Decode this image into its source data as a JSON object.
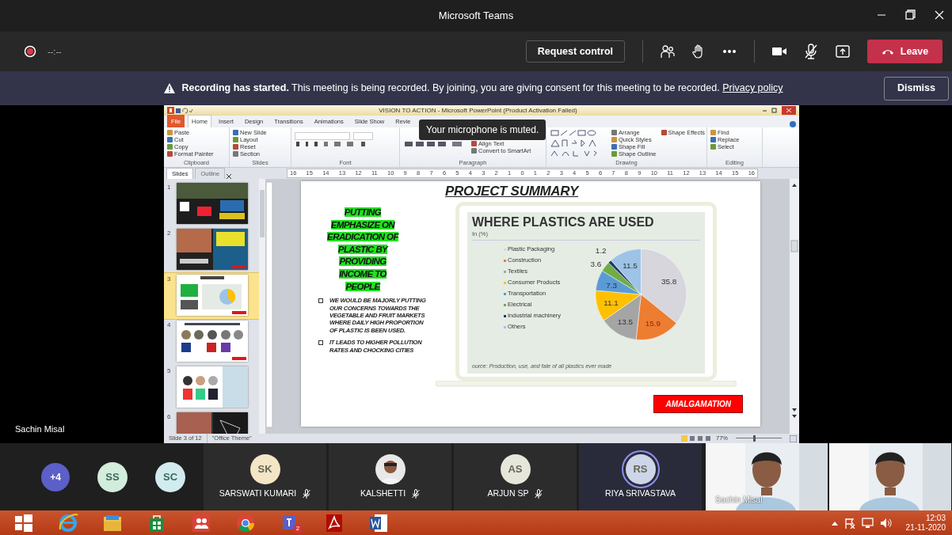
{
  "window": {
    "title": "Microsoft Teams"
  },
  "toolbar": {
    "recording": true,
    "timer": "--:--",
    "request_button": "Request control",
    "leave_button": "Leave"
  },
  "banner": {
    "text": "**Recording has started.**  This meeting is being recorded. By joining, you are giving consent for this meeting to be recorded.",
    "link": "Privacy policy",
    "dismiss": "Dismiss"
  },
  "shared_screen": {
    "presenter": "Sachin Misal",
    "ppt_title": "VISION  TO ACTION - Microsoft PowerPoint (Product Activation Failed)",
    "tabs": [
      {
        "label": "File",
        "kind": "file",
        "selected": false
      },
      {
        "label": "Home",
        "kind": "tab",
        "selected": true
      },
      {
        "label": "Insert",
        "kind": "tab",
        "selected": false
      },
      {
        "label": "Design",
        "kind": "tab",
        "selected": false
      },
      {
        "label": "Transitions",
        "kind": "tab",
        "selected": false
      },
      {
        "label": "Animations",
        "kind": "tab",
        "selected": false
      },
      {
        "label": "Slide Show",
        "kind": "tab",
        "selected": false
      },
      {
        "label": "Revie",
        "kind": "tab",
        "selected": false
      }
    ],
    "ribbon_groups": [
      {
        "label": "Clipboard",
        "commands": [
          "Paste",
          "Cut",
          "Copy",
          "Format Painter"
        ]
      },
      {
        "label": "Slides",
        "commands": [
          "New Slide",
          "Layout",
          "Reset",
          "Section"
        ]
      },
      {
        "label": "Font",
        "kind": "font"
      },
      {
        "label": "Paragraph",
        "commands": [
          "Align Text",
          "Convert to SmartArt"
        ]
      },
      {
        "label": "Drawing",
        "commands": [
          "Arrange",
          "Quick Styles",
          "Shape Fill",
          "Shape Outline",
          "Shape Effects"
        ]
      },
      {
        "label": "Editing",
        "commands": [
          "Find",
          "Replace",
          "Select"
        ]
      }
    ],
    "tooltip": "Your microphone is muted.",
    "pane_tabs": [
      {
        "label": "Slides",
        "selected": true
      },
      {
        "label": "Outline",
        "selected": false
      }
    ],
    "ruler": [
      "16",
      "15",
      "14",
      "13",
      "12",
      "11",
      "10",
      "9",
      "8",
      "7",
      "6",
      "5",
      "4",
      "3",
      "2",
      "1",
      "0",
      "1",
      "2",
      "3",
      "4",
      "5",
      "6",
      "7",
      "8",
      "9",
      "10",
      "11",
      "12",
      "13",
      "14",
      "15",
      "16"
    ],
    "thumbnails": [
      {
        "number": "1",
        "selected": false
      },
      {
        "number": "2",
        "selected": false
      },
      {
        "number": "3",
        "selected": true
      },
      {
        "number": "4",
        "selected": false
      },
      {
        "number": "5",
        "selected": false
      },
      {
        "number": "6",
        "selected": false
      }
    ],
    "slide": {
      "title": "PROJECT SUMMARY",
      "highlight": "PUTTING EMPHASIZE ON ERADICATION OF PLASTIC BY PROVIDING INCOME TO PEOPLE",
      "bullets": [
        "WE WOULD BE MAJORLY PUTTING OUR CONCERNS TOWARDS THE VEGETABLE AND FRUIT MARKETS WHERE DAILY HIGH PROPORTION OF PLASTIC IS BEEN USED.",
        "IT LEADS TO HIGHER POLLUTION RATES AND CHOCKING CITIES"
      ],
      "chart_title": "WHERE PLASTICS ARE USED",
      "chart_subtitle": "In (%)",
      "chart_source": "ource: Production, use, and fate of all plastics ever made",
      "chart_data": {
        "type": "pie",
        "categories": [
          "Plastic Packaging",
          "Construction",
          "Textiles",
          "Consumer Products",
          "Transportation",
          "Electrical",
          "Industrial machinery",
          "Others"
        ],
        "values": [
          35.8,
          15.9,
          13.5,
          11.1,
          7.3,
          3.6,
          1.2,
          11.5
        ],
        "colors": [
          "#d6d6dc",
          "#ed7d31",
          "#a5a5a5",
          "#ffc000",
          "#5b9bd5",
          "#70ad47",
          "#1f3864",
          "#9dc3e6"
        ],
        "legend": "left",
        "data_labels": true
      },
      "tag": "AMALGAMATION"
    },
    "status": {
      "slide_count": "Slide 3 of 12",
      "theme": "\"Office Theme\"",
      "zoom": "77%",
      "zoom_slider": {
        "level": 0.4
      }
    }
  },
  "participants": [
    {
      "kind": "overflow",
      "initials": "+4",
      "color": "#5b5fc7"
    },
    {
      "kind": "avatar",
      "initials": "SS",
      "color": "#d3ecdc"
    },
    {
      "kind": "avatar",
      "initials": "SC",
      "color": "#d2ebef"
    },
    {
      "kind": "tile",
      "initials": "SK",
      "color": "#f4e5c6",
      "name": "SARSWATI KUMARI",
      "muted": true,
      "speaking": false
    },
    {
      "name": "KALSHETTI",
      "muted": true,
      "speaking": false
    },
    {
      "kind": "tile",
      "initials": "AS",
      "color": "#e6e6da",
      "name": "ARJUN SP",
      "muted": true,
      "speaking": false
    },
    {
      "kind": "tile",
      "initials": "RS",
      "color": "#cdd5e8",
      "name": "RIYA SRIVASTAVA",
      "muted": false,
      "speaking": true
    },
    {
      "kind": "video",
      "name": "Sachin Misal"
    },
    {
      "kind": "video"
    }
  ],
  "taskbar": {
    "apps": [
      {
        "kind": "start"
      },
      {
        "kind": "ie"
      },
      {
        "kind": "explorer"
      },
      {
        "kind": "store"
      },
      {
        "kind": "people"
      },
      {
        "kind": "chrome"
      },
      {
        "kind": "teams",
        "badge": "2"
      },
      {
        "kind": "acrobat"
      },
      {
        "kind": "word"
      }
    ],
    "time": "12:03",
    "date": "21-11-2020"
  }
}
